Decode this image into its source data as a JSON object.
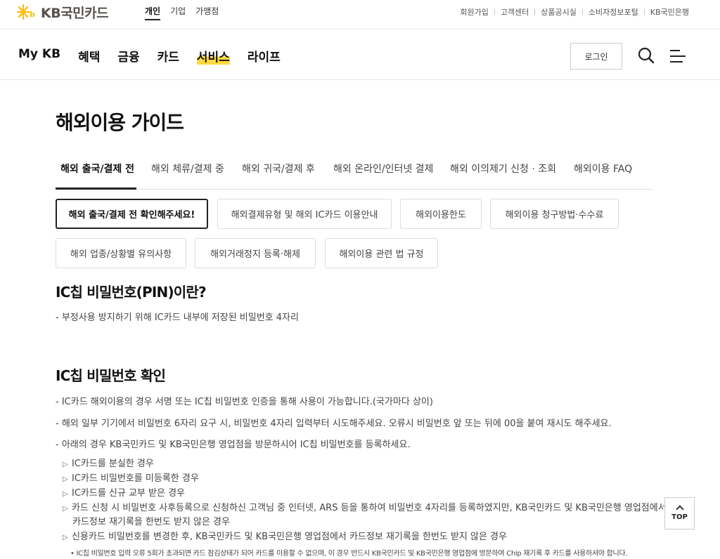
{
  "header": {
    "logo_text": "KB국민카드",
    "segments": [
      "개인",
      "기업",
      "가맹점"
    ],
    "util_links": [
      "회원가입",
      "고객센터",
      "상품공시실",
      "소비자정보포털",
      "KB국민은행"
    ],
    "brand_color": "#ffbc00"
  },
  "gnb": {
    "menu": [
      "My KB",
      "혜택",
      "금융",
      "카드",
      "서비스",
      "라이프"
    ],
    "highlight_index": 4,
    "login_label": "로그인"
  },
  "page": {
    "title": "해외이용 가이드",
    "tabs": [
      "해외 출국/결제 전",
      "해외 체류/결제 중",
      "해외 귀국/결제 후",
      "해외 온라인/인터넷 결제",
      "해외 이의제기 신청 · 조회",
      "해외이용 FAQ"
    ],
    "active_tab": 0,
    "chips": [
      "해외 출국/결제 전 확인해주세요!",
      "해외결제유형 및 해외 IC카드 이용안내",
      "해외이용한도",
      "해외이용 청구방법·수수료",
      "해외 업종/상황별 유의사항",
      "해외거래정지 등록·해제",
      "해외이용 관련 법 규정"
    ],
    "active_chip": 0
  },
  "section1": {
    "heading": "IC칩 비밀번호(PIN)이란?",
    "desc": "- 부정사용 방지하기 위해 IC카드 내부에 저장된 비밀번호 4자리"
  },
  "section2": {
    "heading": "IC칩 비밀번호 확인",
    "lines": [
      "- IC카드 해외이용의 경우 서명 또는 IC칩 비밀번호 인증을 통해 사용이 가능합니다.(국가마다 상이)",
      "- 해외 일부 기기에서 비밀번호 6자리 요구 시, 비밀번호 4자리 입력부터 시도해주세요. 오류시 비밀번호 앞 또는 뒤에 00을 붙여 재시도 해주세요.",
      "- 아래의 경우 KB국민카드 및 KB국민은행 영업점을 방문하시어 IC칩 비밀번호를 등록하세요."
    ],
    "cases": [
      "IC카드를 분실한 경우",
      "IC카드 비밀번호를 미등록한 경우",
      "IC카드를 신규 교부 받은 경우",
      "카드 신청 시 비밀번호 사후등록으로 신청하신 고객님 중 인터넷, ARS 등을 통하여 비밀번호 4자리를 등록하였지만, KB국민카드 및 KB국민은행 영업점에서",
      "신용카드 비밀번호를 변경한 후, KB국민카드 및 KB국민은행 영업점에서 카드정보 재기록을 한번도 받지 않은 경우"
    ],
    "case4_cont": "카드정보 재기록을 한번도 받지 않은 경우",
    "note": "• IC칩 비밀번호 입력 오류 5회가 초과되면 카드 잠김상태가 되어 카드를 이용할 수 없으며, 이 경우 반드시 KB국민카드 및 KB국민은행 영업점에 방문하여 Chip 재기록 후 카드를 사용하셔야 합니다."
  },
  "top_button": "TOP"
}
